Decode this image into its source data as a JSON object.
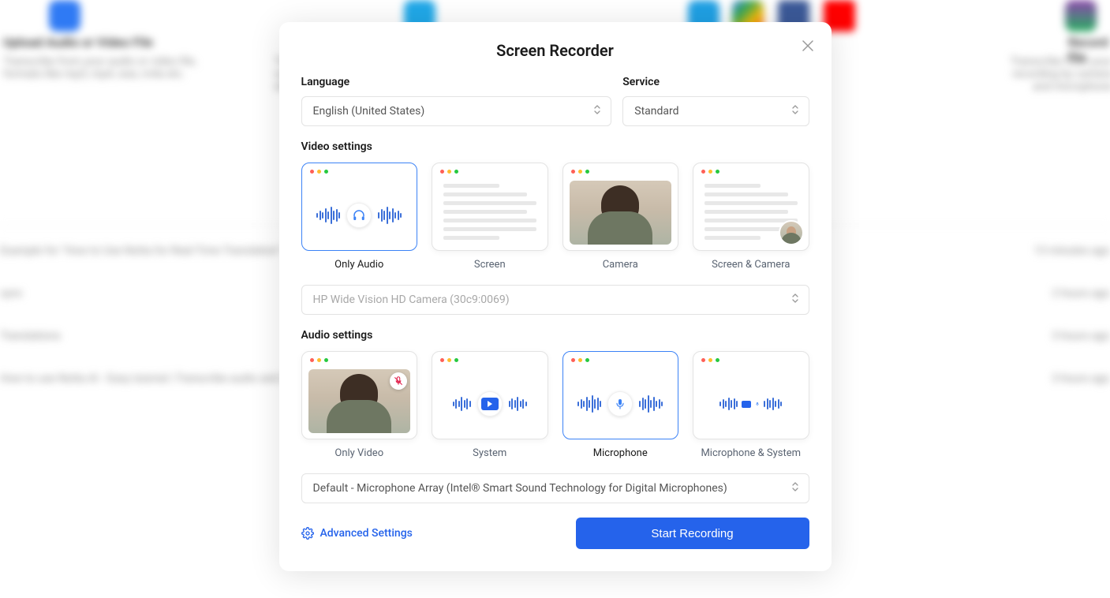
{
  "modal": {
    "title": "Screen Recorder",
    "language": {
      "label": "Language",
      "value": "English (United States)"
    },
    "service": {
      "label": "Service",
      "value": "Standard"
    },
    "videoSettings": {
      "label": "Video settings",
      "options": {
        "onlyAudio": "Only Audio",
        "screen": "Screen",
        "camera": "Camera",
        "screenCamera": "Screen & Camera"
      },
      "cameraSelect": "HP Wide Vision HD Camera (30c9:0069)"
    },
    "audioSettings": {
      "label": "Audio settings",
      "options": {
        "onlyVideo": "Only Video",
        "system": "System",
        "microphone": "Microphone",
        "microphoneSystem": "Microphone & System"
      },
      "micSelect": "Default - Microphone Array (Intel® Smart Sound Technology for Digital Microphones)"
    },
    "advancedSettings": "Advanced Settings",
    "startRecording": "Start Recording"
  }
}
